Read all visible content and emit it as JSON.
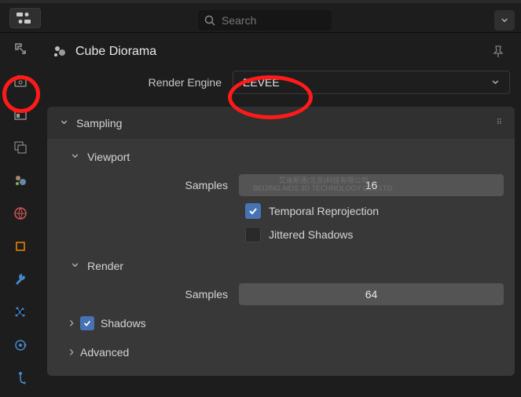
{
  "header": {
    "search_placeholder": "Search"
  },
  "title": "Cube Diorama",
  "engine": {
    "label": "Render Engine",
    "value": "EEVEE"
  },
  "sampling": {
    "title": "Sampling",
    "viewport": {
      "title": "Viewport",
      "samples_label": "Samples",
      "samples_value": "16",
      "temporal_label": "Temporal Reprojection",
      "jittered_label": "Jittered Shadows"
    },
    "render": {
      "title": "Render",
      "samples_label": "Samples",
      "samples_value": "64"
    },
    "shadows_label": "Shadows",
    "advanced_label": "Advanced"
  },
  "watermark": {
    "line1": "艾迪斯通(北京)科技有限公司",
    "line2": "BEIJING AIDS 3D TECHNOLOGY CO., LTD."
  },
  "rail": {
    "tools": "tool",
    "render": "render",
    "output": "output",
    "viewlayer": "viewlayer",
    "scene": "scene",
    "world": "world",
    "object": "object",
    "modifiers": "modifiers",
    "particles": "particles",
    "physics": "physics",
    "constraints": "constraints"
  }
}
